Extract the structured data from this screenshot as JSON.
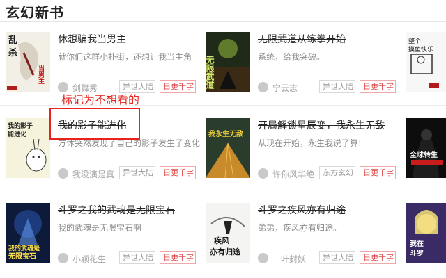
{
  "section": {
    "title": "玄幻新书"
  },
  "annotation": {
    "label": "标记为不想看的"
  },
  "update_tag": "日更千字",
  "books": [
    {
      "title": "休想骗我当男主",
      "desc": "就你们这群小扑街，还想让我当主角",
      "author": "剑舞秀",
      "category": "异世大陆",
      "strike": false
    },
    {
      "title": "无限武道从练拳开始",
      "desc": "系统，给我突破。",
      "author": "宁云志",
      "category": "异世大陆",
      "strike": true
    },
    {
      "title": "我的影子能进化",
      "desc": "方休突然发现了自己的影子发生了变化",
      "author": "我没演是真",
      "category": "异世大陆",
      "strike": true
    },
    {
      "title": "开局解锁星辰变，我永生无敌",
      "desc": "从现在开始，永生我说了算!",
      "author": "许你风华绝",
      "category": "东方玄幻",
      "strike": true
    },
    {
      "title": "斗罗之我的武魂是无限宝石",
      "desc": "我的武魂是无限宝石啊",
      "author": "小颖花生",
      "category": "异世大陆",
      "strike": true
    },
    {
      "title": "斗罗之疾风亦有归途",
      "desc": "弟弟，疾风亦有归途。",
      "author": "一叶封妖",
      "category": "异世大陆",
      "strike": true
    }
  ],
  "covers": {
    "c1": [
      "乱",
      "杀",
      "当男主"
    ],
    "c2": [
      "无限武道"
    ],
    "c3": [
      "我的影子",
      "能进化"
    ],
    "c4": [
      "我永生无敌"
    ],
    "c5": [
      "我的武魂是",
      "无限宝石"
    ],
    "c6": [
      "疾风",
      "亦有归途"
    ]
  },
  "partials": {
    "p1": [
      "整个",
      "摸鱼快乐"
    ],
    "p2": [
      "全球转生"
    ],
    "p3": [
      "我在",
      "斗罗"
    ]
  }
}
